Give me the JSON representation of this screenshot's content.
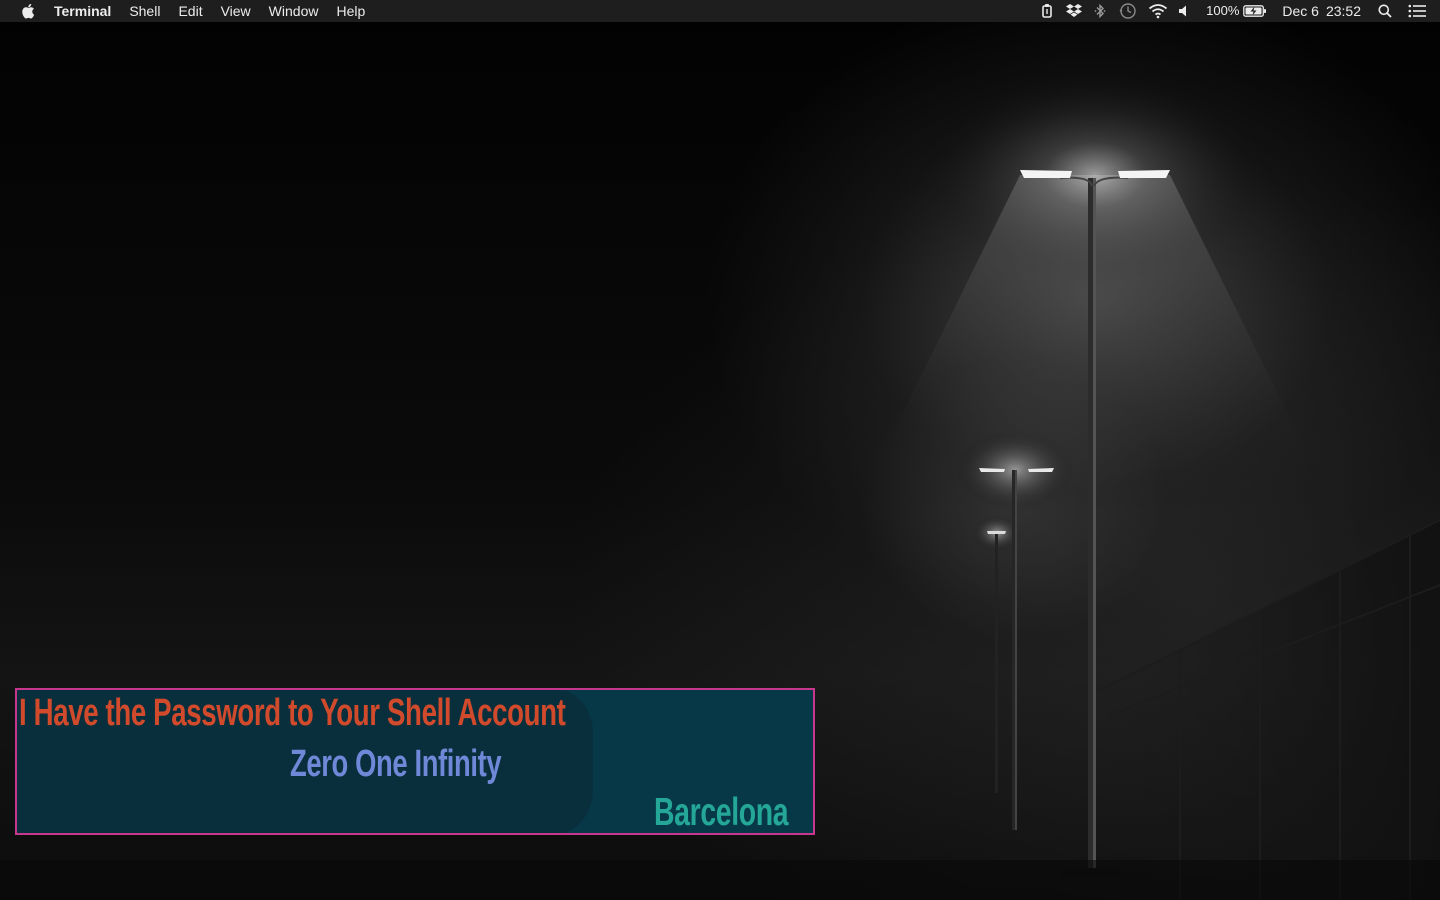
{
  "menubar": {
    "app_name": "Terminal",
    "menus": [
      "Shell",
      "Edit",
      "View",
      "Window",
      "Help"
    ],
    "status": {
      "icons": [
        "clipboard-icon",
        "dropbox-icon",
        "bluetooth-icon",
        "time-machine-icon",
        "wifi-icon",
        "volume-icon"
      ],
      "battery_percent": "100%",
      "date": "Dec 6",
      "time": "23:52"
    }
  },
  "widget": {
    "line1": "I Have the Password to Your Shell Account",
    "line2": "Zero One Infinity",
    "line3": "Barcelona",
    "colors": {
      "line1": "#d14a2b",
      "line2": "#6f89d8",
      "line3": "#25a797",
      "border": "#c8378e",
      "background": "#063848"
    }
  },
  "wallpaper": {
    "description_icon": "foggy-street-lamps-wallpaper"
  }
}
